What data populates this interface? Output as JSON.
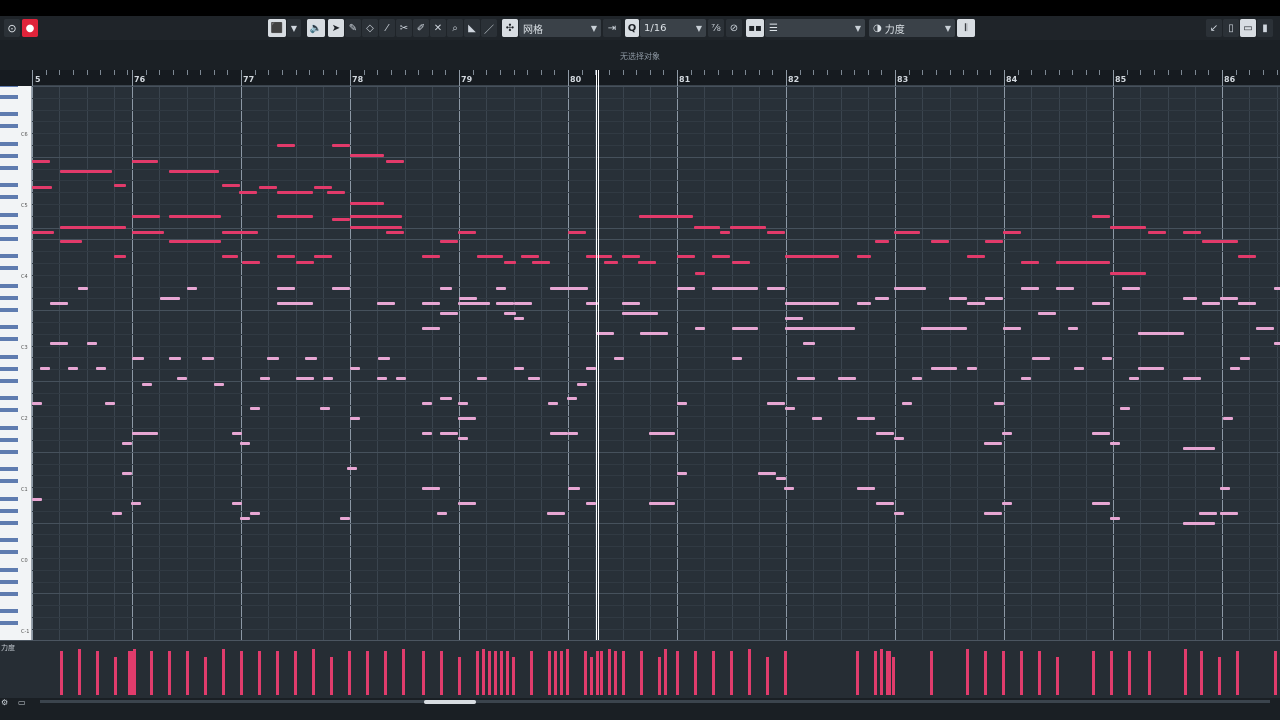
{
  "toolbar": {
    "snap_type": "网格",
    "quantize": "Q",
    "quantize_value": "1/16",
    "length_percent": "⅞",
    "velocity_mode": "力度"
  },
  "status": {
    "selection_text": "无选择对象"
  },
  "ruler": {
    "bars": [
      "5",
      "76",
      "77",
      "78",
      "79",
      "80",
      "81",
      "82",
      "83",
      "84",
      "85",
      "86"
    ]
  },
  "keyboard": {
    "octave_labels": [
      "C6",
      "C5",
      "C4",
      "C3",
      "C2",
      "C1",
      "C0",
      "C-1"
    ]
  },
  "velocity_lane": {
    "label": "力度"
  },
  "colors": {
    "note_melody": "#e23a6a",
    "note_accompaniment": "#e7a6d3",
    "grid_bg": "#283038"
  },
  "icons": [
    "solo-icon",
    "record-icon",
    "object-select-icon",
    "speaker-icon",
    "pointer-icon",
    "pencil-icon",
    "eraser-icon",
    "draw-line-icon",
    "scissors-icon",
    "glue-icon",
    "mute-icon",
    "zoom-icon",
    "color-icon",
    "snap-icon",
    "quantize-icon",
    "piano-icon"
  ]
}
